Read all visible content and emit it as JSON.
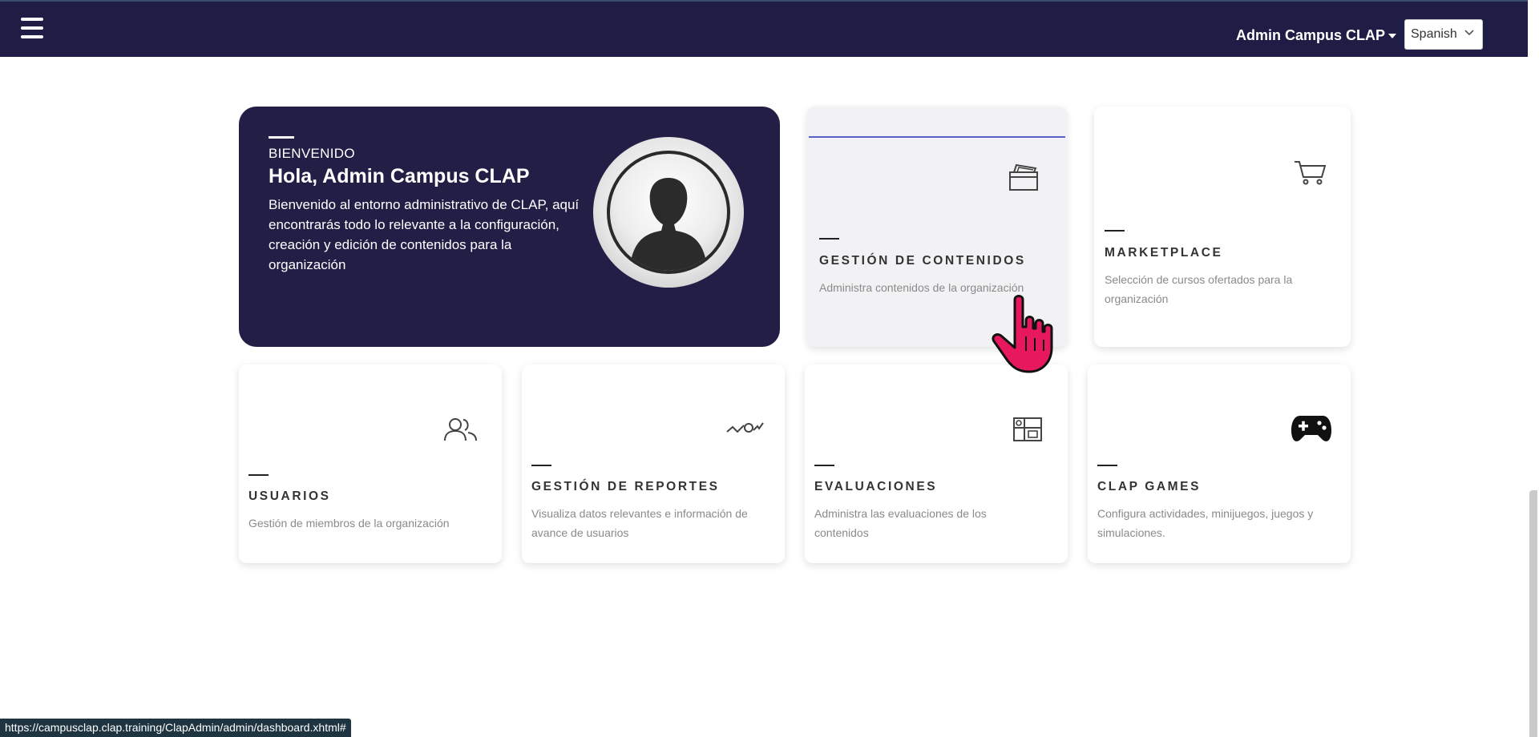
{
  "header": {
    "user_name": "Admin Campus CLAP",
    "language": "Spanish"
  },
  "welcome": {
    "kicker": "BIENVENIDO",
    "greeting": "Hola, Admin Campus CLAP",
    "description": "Bienvenido al entorno administrativo de CLAP, aquí encontrarás todo lo relevante a la configuración, creación y edición de contenidos para la organización"
  },
  "cards": [
    {
      "title": "GESTIÓN DE CONTENIDOS",
      "text": "Administra contenidos de la organización",
      "icon": "content-folder-icon"
    },
    {
      "title": "MARKETPLACE",
      "text": "Selección de cursos ofertados para la organización",
      "icon": "cart-icon"
    },
    {
      "title": "USUARIOS",
      "text": "Gestión de miembros de la organización",
      "icon": "users-icon"
    },
    {
      "title": "GESTIÓN DE REPORTES",
      "text": "Visualiza datos relevantes e información de avance de usuarios",
      "icon": "report-chart-icon"
    },
    {
      "title": "EVALUACIONES",
      "text": "Administra las evaluaciones de los contenidos",
      "icon": "evaluation-grid-icon"
    },
    {
      "title": "CLAP GAMES",
      "text": "Configura actividades, minijuegos, juegos y simulaciones.",
      "icon": "gamepad-icon"
    }
  ],
  "status_url": "https://campusclap.clap.training/ClapAdmin/admin/dashboard.xhtml#",
  "colors": {
    "navy": "#1f1c45",
    "accent_line": "#5a5ec8",
    "cursor": "#e8185e"
  }
}
